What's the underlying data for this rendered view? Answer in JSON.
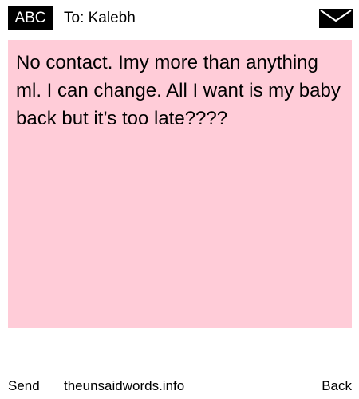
{
  "header": {
    "badge_label": "ABC",
    "to_label": "To: Kalebh",
    "envelope_icon": "envelope-icon"
  },
  "message": {
    "text": "No contact. Imy more than anything ml. I can change. All I want is my baby back but it’s too late????",
    "background_color": "#ffccd8"
  },
  "footer": {
    "send_label": "Send",
    "site_label": "theunsaidwords.info",
    "back_label": "Back"
  }
}
